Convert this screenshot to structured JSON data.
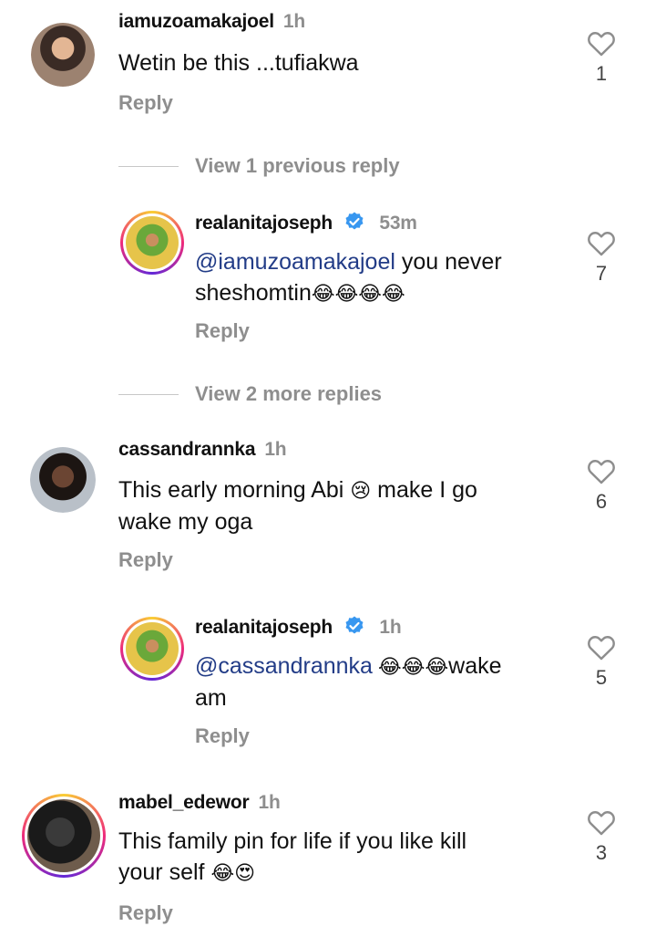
{
  "comments": [
    {
      "username": "iamuzoamakajoel",
      "time": "1h",
      "text": "Wetin be this ...tufiakwa",
      "reply_label": "Reply",
      "likes": "1"
    },
    {
      "view_label": "View 1 previous reply"
    },
    {
      "username": "realanitajoseph",
      "time": "53m",
      "mention": "@iamuzoamakajoel",
      "text_after": " you never",
      "text_line2": "sheshomtin",
      "emojis": "😂😂😂😂",
      "reply_label": "Reply",
      "likes": "7"
    },
    {
      "view_label": "View 2 more replies"
    },
    {
      "username": "cassandrannka",
      "time": "1h",
      "text_line1": "This early morning Abi",
      "emoji1": "😢",
      "text_line1b": " make I go",
      "text_line2": "wake my oga",
      "reply_label": "Reply",
      "likes": "6"
    },
    {
      "username": "realanitajoseph",
      "time": "1h",
      "mention": "@cassandrannka",
      "emojis": " 😂😂😂",
      "text_after": "wake",
      "text_line2": "am",
      "reply_label": "Reply",
      "likes": "5"
    },
    {
      "username": "mabel_edewor",
      "time": "1h",
      "text_line1": "This family pin for life if you like kill",
      "text_line2": "your self ",
      "emojis": "😂😍",
      "reply_label": "Reply",
      "likes": "3"
    }
  ],
  "colors": {
    "mention": "#223c87",
    "muted": "#8e8e8e",
    "verified": "#3897f0"
  },
  "icons": [
    "heart-outline-icon",
    "verified-badge-icon"
  ]
}
